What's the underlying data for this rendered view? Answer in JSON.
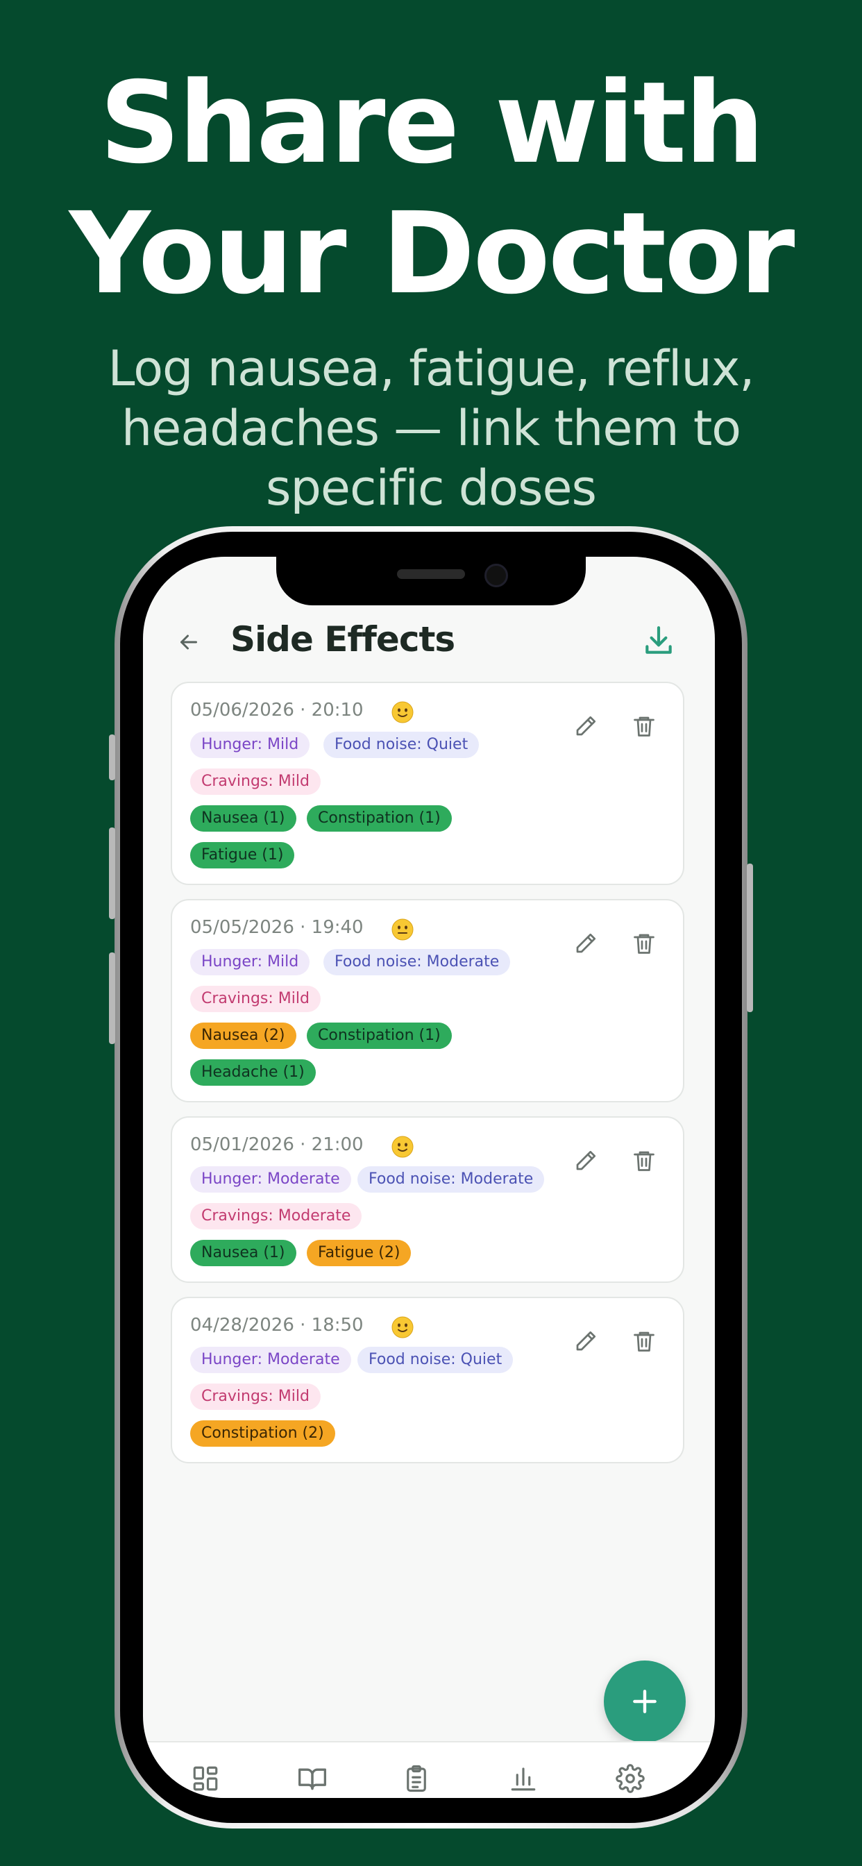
{
  "headline": {
    "line1": "Share with",
    "line2": "Your Doctor"
  },
  "subhead": {
    "line1": "Log nausea, fatigue, reflux,",
    "line2": "headaches — link them to",
    "line3": "specific doses"
  },
  "colors": {
    "background": "#054a2d",
    "accent": "#2a9d7d",
    "mild_tag": "#2eab5c",
    "moderate_tag": "#f5a623"
  },
  "app": {
    "title": "Side Effects",
    "back_icon": "arrow-left-icon",
    "export_icon": "download-icon",
    "fab_icon": "plus-icon",
    "entries": [
      {
        "date": "05/06/2026 · 20:10",
        "mood": "slightly-smiling-face",
        "hunger": "Hunger: Mild",
        "food_noise": "Food noise: Quiet",
        "cravings": "Cravings: Mild",
        "symptoms": [
          {
            "label": "Nausea (1)",
            "severity": 1
          },
          {
            "label": "Constipation (1)",
            "severity": 1
          },
          {
            "label": "Fatigue (1)",
            "severity": 1
          }
        ]
      },
      {
        "date": "05/05/2026 · 19:40",
        "mood": "neutral-face",
        "hunger": "Hunger: Mild",
        "food_noise": "Food noise: Moderate",
        "cravings": "Cravings: Mild",
        "symptoms": [
          {
            "label": "Nausea (2)",
            "severity": 2
          },
          {
            "label": "Constipation (1)",
            "severity": 1
          },
          {
            "label": "Headache (1)",
            "severity": 1
          }
        ]
      },
      {
        "date": "05/01/2026 · 21:00",
        "mood": "slightly-smiling-face",
        "hunger": "Hunger: Moderate",
        "food_noise": "Food noise: Moderate",
        "cravings": "Cravings: Moderate",
        "symptoms": [
          {
            "label": "Nausea (1)",
            "severity": 1
          },
          {
            "label": "Fatigue (2)",
            "severity": 2
          }
        ]
      },
      {
        "date": "04/28/2026 · 18:50",
        "mood": "slightly-smiling-face",
        "hunger": "Hunger: Moderate",
        "food_noise": "Food noise: Quiet",
        "cravings": "Cravings: Mild",
        "symptoms": [
          {
            "label": "Constipation (2)",
            "severity": 2
          }
        ]
      }
    ],
    "nav": [
      "dashboard-icon",
      "book-icon",
      "clipboard-icon",
      "bar-chart-icon",
      "settings-icon"
    ]
  }
}
